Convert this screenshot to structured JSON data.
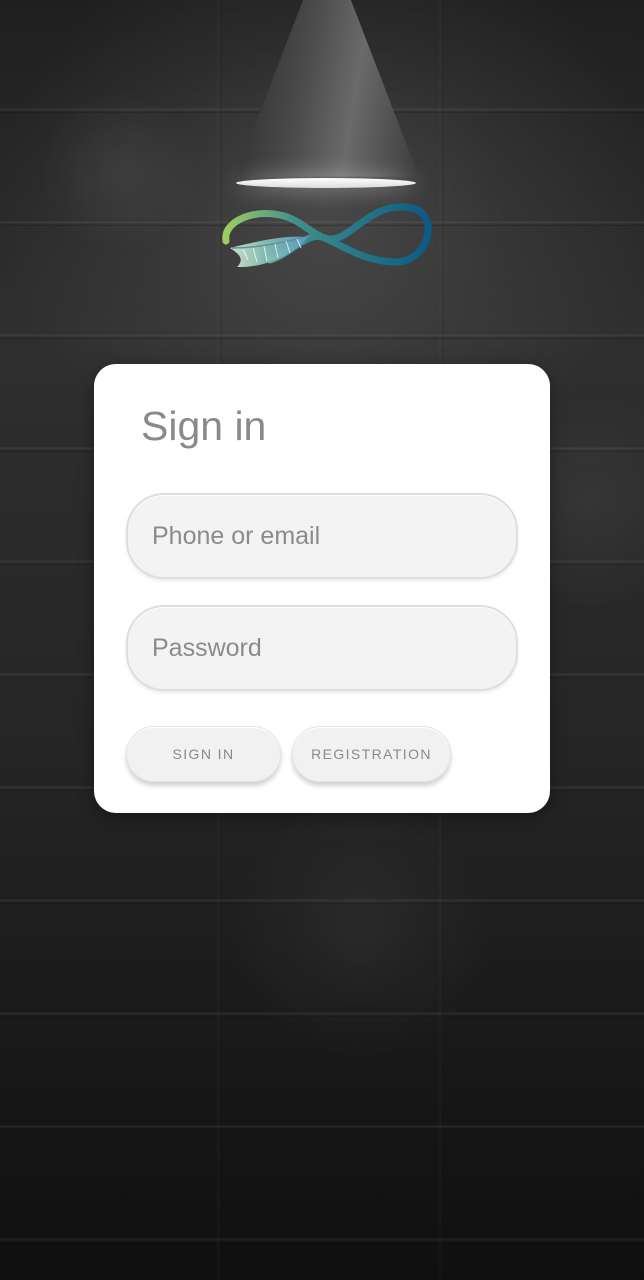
{
  "app": {
    "logo_icon": "infinity-feather-logo-icon",
    "lamp_icon": "ceiling-lamp-icon",
    "background": "dark-brick-wall"
  },
  "signin": {
    "title": "Sign in",
    "phone_email_placeholder": "Phone or email",
    "password_placeholder": "Password",
    "sign_in_button": "SIGN IN",
    "registration_button": "REGISTRATION"
  },
  "colors": {
    "card": "#ffffff",
    "input_fill": "#f3f3f3",
    "text_muted": "#8a8a8a",
    "logo_green": "#8bc34a",
    "logo_blue": "#0b5b86"
  }
}
